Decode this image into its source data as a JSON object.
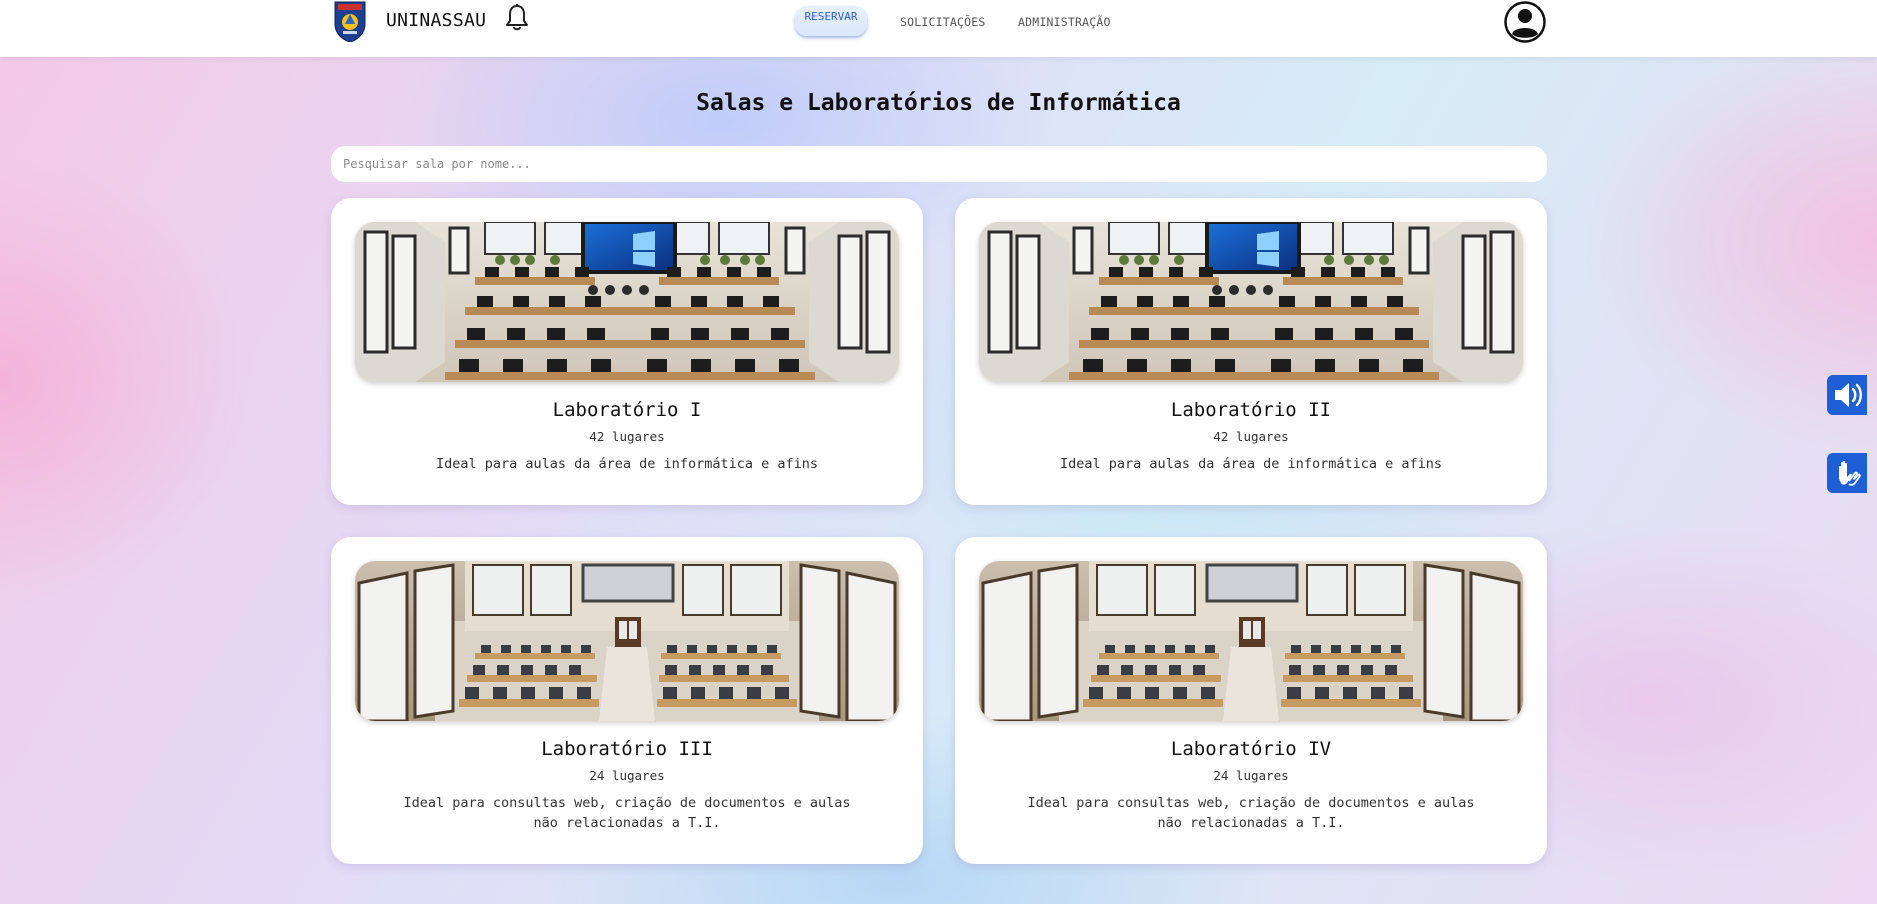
{
  "header": {
    "brand": "UNINASSAU",
    "nav": {
      "reservar": "RESERVAR",
      "solicitacoes": "SOLICITAÇÕES",
      "administracao": "ADMINISTRAÇÃO"
    },
    "icons": [
      "logo-shield",
      "bell-icon",
      "user-avatar-icon"
    ]
  },
  "main": {
    "title": "Salas e Laboratórios de Informática",
    "search": {
      "placeholder": "Pesquisar sala por nome...",
      "value": ""
    },
    "rooms": [
      {
        "name": "Laboratório I",
        "capacity": "42 lugares",
        "description": "Ideal para aulas da área de informática e afins"
      },
      {
        "name": "Laboratório II",
        "capacity": "42 lugares",
        "description": "Ideal para aulas da área de informática e afins"
      },
      {
        "name": "Laboratório III",
        "capacity": "24 lugares",
        "description": "Ideal para consultas web, criação de documentos e aulas não relacionadas a T.I."
      },
      {
        "name": "Laboratório IV",
        "capacity": "24 lugares",
        "description": "Ideal para consultas web, criação de documentos e aulas não relacionadas a T.I."
      }
    ]
  },
  "accessibility": {
    "icons": [
      "audio-icon",
      "sign-language-icon"
    ]
  },
  "colors": {
    "accent": "#2a5fd0",
    "widget": "#1f5fd6",
    "card": "#ffffff"
  }
}
